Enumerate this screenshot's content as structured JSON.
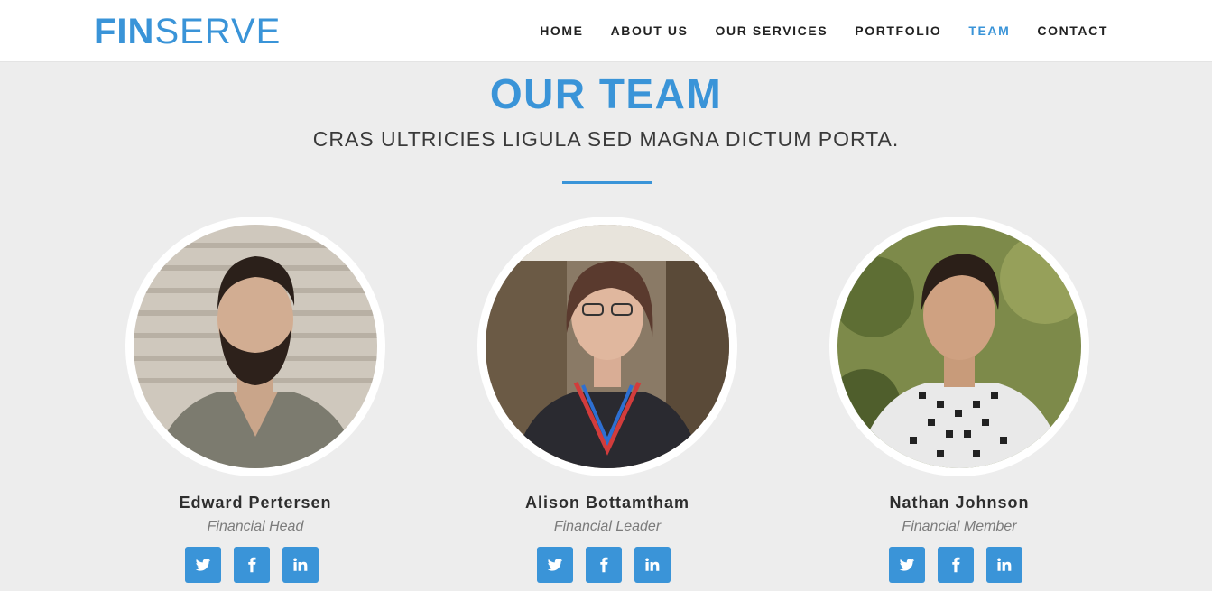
{
  "brand": {
    "bold": "FIN",
    "light": "SERVE"
  },
  "nav": {
    "items": [
      "HOME",
      "ABOUT US",
      "OUR SERVICES",
      "PORTFOLIO",
      "TEAM",
      "CONTACT"
    ],
    "active": "TEAM"
  },
  "section": {
    "title": "OUR TEAM",
    "subtitle": "CRAS ULTRICIES LIGULA SED MAGNA DICTUM PORTA."
  },
  "team": [
    {
      "name": "Edward Pertersen",
      "role": "Financial Head"
    },
    {
      "name": "Alison Bottamtham",
      "role": "Financial Leader"
    },
    {
      "name": "Nathan Johnson",
      "role": "Financial Member"
    }
  ],
  "social_icons": [
    "twitter-icon",
    "facebook-icon",
    "linkedin-icon"
  ],
  "colors": {
    "accent": "#3a94d8",
    "background": "#ededed",
    "header": "#ffffff"
  }
}
